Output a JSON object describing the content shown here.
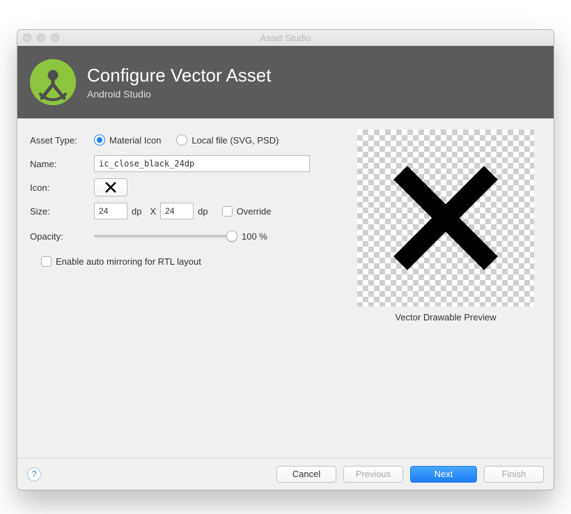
{
  "window": {
    "title": "Asset Studio"
  },
  "banner": {
    "title": "Configure Vector Asset",
    "subtitle": "Android Studio"
  },
  "form": {
    "asset_type": {
      "label": "Asset Type:",
      "options": {
        "material": "Material Icon",
        "local": "Local file (SVG, PSD)"
      },
      "selected": "material"
    },
    "name": {
      "label": "Name:",
      "value": "ic_close_black_24dp"
    },
    "icon": {
      "label": "Icon:"
    },
    "size": {
      "label": "Size:",
      "width": "24",
      "height": "24",
      "unit": "dp",
      "sep": "X",
      "override_label": "Override"
    },
    "opacity": {
      "label": "Opacity:",
      "value_text": "100 %",
      "value": 100
    },
    "rtl": {
      "label": "Enable auto mirroring for RTL layout",
      "checked": false
    }
  },
  "preview": {
    "caption": "Vector Drawable Preview"
  },
  "footer": {
    "help": "?",
    "cancel": "Cancel",
    "previous": "Previous",
    "next": "Next",
    "finish": "Finish"
  }
}
